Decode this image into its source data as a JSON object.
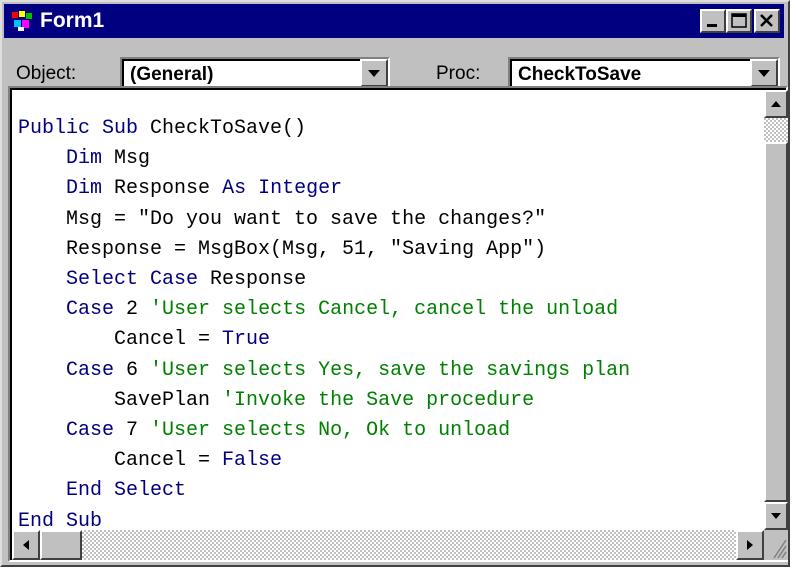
{
  "window": {
    "title": "Form1"
  },
  "toolbar": {
    "object_label": "Object:",
    "object_value": "(General)",
    "proc_label": "Proc:",
    "proc_value": "CheckToSave"
  },
  "code_lines": [
    [
      {
        "t": "kw",
        "s": "Public Sub"
      },
      {
        "t": "tx",
        "s": " CheckToSave()"
      }
    ],
    [
      {
        "t": "tx",
        "s": "    "
      },
      {
        "t": "kw",
        "s": "Dim"
      },
      {
        "t": "tx",
        "s": " Msg"
      }
    ],
    [
      {
        "t": "tx",
        "s": "    "
      },
      {
        "t": "kw",
        "s": "Dim"
      },
      {
        "t": "tx",
        "s": " Response "
      },
      {
        "t": "kw",
        "s": "As Integer"
      }
    ],
    [
      {
        "t": "tx",
        "s": "    Msg = \"Do you want to save the changes?\""
      }
    ],
    [
      {
        "t": "tx",
        "s": "    Response = MsgBox(Msg, 51, \"Saving App\")"
      }
    ],
    [
      {
        "t": "tx",
        "s": "    "
      },
      {
        "t": "kw",
        "s": "Select Case"
      },
      {
        "t": "tx",
        "s": " Response"
      }
    ],
    [
      {
        "t": "tx",
        "s": "    "
      },
      {
        "t": "kw",
        "s": "Case"
      },
      {
        "t": "tx",
        "s": " 2 "
      },
      {
        "t": "cm",
        "s": "'User selects Cancel, cancel the unload"
      }
    ],
    [
      {
        "t": "tx",
        "s": "        Cancel = "
      },
      {
        "t": "kw",
        "s": "True"
      }
    ],
    [
      {
        "t": "tx",
        "s": "    "
      },
      {
        "t": "kw",
        "s": "Case"
      },
      {
        "t": "tx",
        "s": " 6 "
      },
      {
        "t": "cm",
        "s": "'User selects Yes, save the savings plan"
      }
    ],
    [
      {
        "t": "tx",
        "s": "        SavePlan "
      },
      {
        "t": "cm",
        "s": "'Invoke the Save procedure"
      }
    ],
    [
      {
        "t": "tx",
        "s": "    "
      },
      {
        "t": "kw",
        "s": "Case"
      },
      {
        "t": "tx",
        "s": " 7 "
      },
      {
        "t": "cm",
        "s": "'User selects No, Ok to unload"
      }
    ],
    [
      {
        "t": "tx",
        "s": "        Cancel = "
      },
      {
        "t": "kw",
        "s": "False"
      }
    ],
    [
      {
        "t": "tx",
        "s": "    "
      },
      {
        "t": "kw",
        "s": "End Select"
      }
    ],
    [
      {
        "t": "kw",
        "s": "End Sub"
      }
    ]
  ],
  "icons": {
    "app": "vb-form-icon",
    "minimize": "minimize-icon",
    "maximize": "maximize-icon",
    "close": "close-icon",
    "dropdown": "chevron-down-icon",
    "scroll_up": "arrow-up-icon",
    "scroll_down": "arrow-down-icon",
    "scroll_left": "arrow-left-icon",
    "scroll_right": "arrow-right-icon"
  },
  "colors": {
    "titlebar": "#000080",
    "keyword": "#000080",
    "comment": "#008000",
    "face": "#c0c0c0"
  }
}
